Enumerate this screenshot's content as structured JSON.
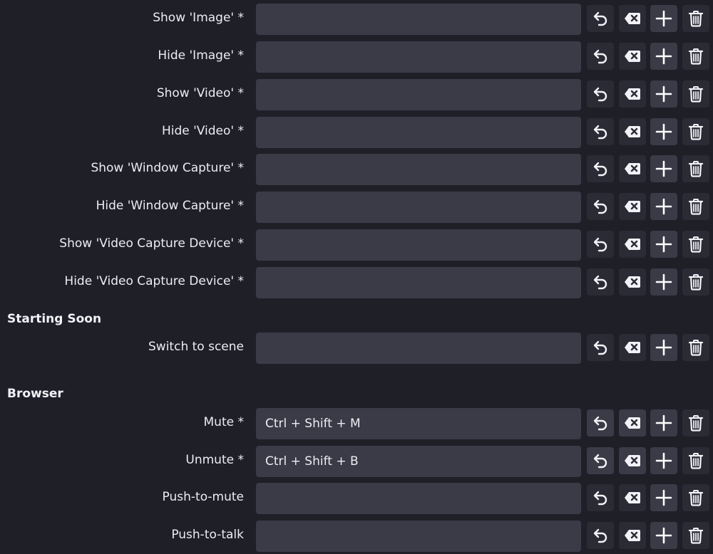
{
  "rows_top": [
    {
      "label": "Show 'Image' *",
      "value": ""
    },
    {
      "label": "Hide 'Image' *",
      "value": ""
    },
    {
      "label": "Show 'Video' *",
      "value": ""
    },
    {
      "label": "Hide 'Video' *",
      "value": ""
    },
    {
      "label": "Show 'Window Capture' *",
      "value": ""
    },
    {
      "label": "Hide 'Window Capture' *",
      "value": ""
    },
    {
      "label": "Show 'Video Capture Device' *",
      "value": ""
    },
    {
      "label": "Hide 'Video Capture Device' *",
      "value": ""
    }
  ],
  "sections": [
    {
      "title": "Starting Soon",
      "rows": [
        {
          "label": "Switch to scene",
          "value": ""
        }
      ]
    },
    {
      "title": "Browser",
      "rows": [
        {
          "label": "Mute *",
          "value": "Ctrl + Shift + M"
        },
        {
          "label": "Unmute *",
          "value": "Ctrl + Shift + B"
        },
        {
          "label": "Push-to-mute",
          "value": ""
        },
        {
          "label": "Push-to-talk",
          "value": ""
        }
      ]
    }
  ],
  "icons": {
    "revert": "revert-icon",
    "clear": "clear-icon",
    "add": "add-icon",
    "remove": "trash-icon"
  },
  "colors": {
    "background": "#1f1f28",
    "field": "#3a3b47",
    "button": "#2a2b35",
    "text": "#ececf2"
  }
}
